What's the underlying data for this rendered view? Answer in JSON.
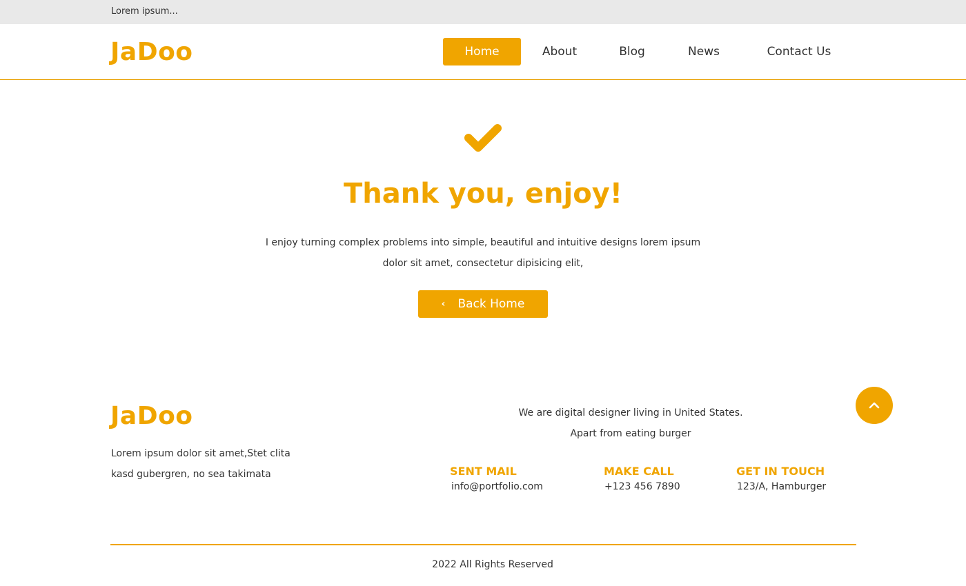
{
  "topbar": {
    "text": "Lorem ipsum..."
  },
  "brand": {
    "logo": "JaDoo",
    "accent_color": "#f0a500"
  },
  "nav": {
    "items": [
      {
        "label": "Home",
        "active": true
      },
      {
        "label": "About",
        "active": false
      },
      {
        "label": "Blog",
        "active": false
      },
      {
        "label": "News",
        "active": false
      },
      {
        "label": "Contact Us",
        "active": false
      }
    ]
  },
  "hero": {
    "icon": "check-icon",
    "title": "Thank you, enjoy!",
    "text_line1": "I enjoy turning complex problems into simple, beautiful and intuitive designs lorem ipsum",
    "text_line2": "dolor sit amet, consectetur dipisicing elit,",
    "button_icon": "chevron-left-icon",
    "button_label": "Back Home"
  },
  "footer": {
    "logo": "JaDoo",
    "desc_line1": "Lorem ipsum dolor sit amet,Stet clita",
    "desc_line2": "kasd gubergren, no sea takimata",
    "about_line1": "We are digital designer living in United States.",
    "about_line2": "Apart from eating burger",
    "contacts": [
      {
        "heading": "SENT MAIL",
        "value": "info@portfolio.com"
      },
      {
        "heading": "MAKE CALL",
        "value": "+123 456 7890"
      },
      {
        "heading": "GET IN TOUCH",
        "value": "123/A, Hamburger"
      }
    ],
    "scroll_top_icon": "chevron-up-icon",
    "copyright": "2022 All Rights Reserved"
  }
}
